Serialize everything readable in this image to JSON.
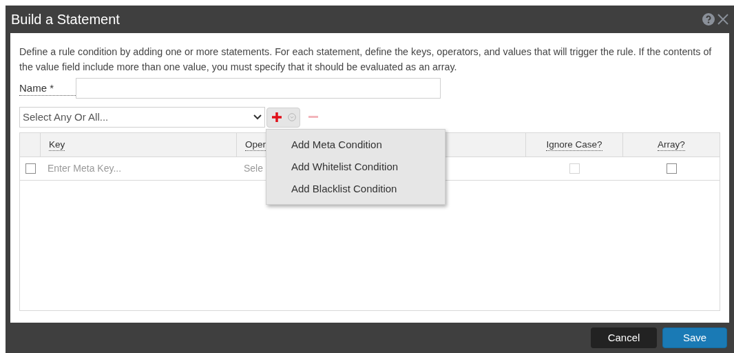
{
  "window": {
    "title": "Build a Statement"
  },
  "description": "Define a rule condition by adding one or more statements. For each statement, define the keys, operators, and values that will trigger the rule. If the contents of the value field include more than one value, you must specify that it should be evaluated as an array.",
  "name_field": {
    "label": "Name *"
  },
  "match_select": {
    "placeholder": "Select Any Or All..."
  },
  "add_menu": {
    "expanded": true,
    "items": [
      {
        "label": "Add Meta Condition"
      },
      {
        "label": "Add Whitelist Condition"
      },
      {
        "label": "Add Blacklist Condition"
      }
    ]
  },
  "remove_button": {
    "disabled": true
  },
  "table": {
    "columns": [
      "Key",
      "Oper",
      null,
      "Ignore Case?",
      "Array?"
    ],
    "rows": [
      {
        "checked": false,
        "key_placeholder": "Enter Meta Key...",
        "operator_placeholder": "Sele",
        "ignore_case": {
          "checked": false,
          "disabled": true
        },
        "array": {
          "checked": false,
          "disabled": false
        }
      }
    ]
  },
  "buttons": [
    {
      "label": "Cancel",
      "kind": "secondary"
    },
    {
      "label": "Save",
      "kind": "primary"
    }
  ]
}
